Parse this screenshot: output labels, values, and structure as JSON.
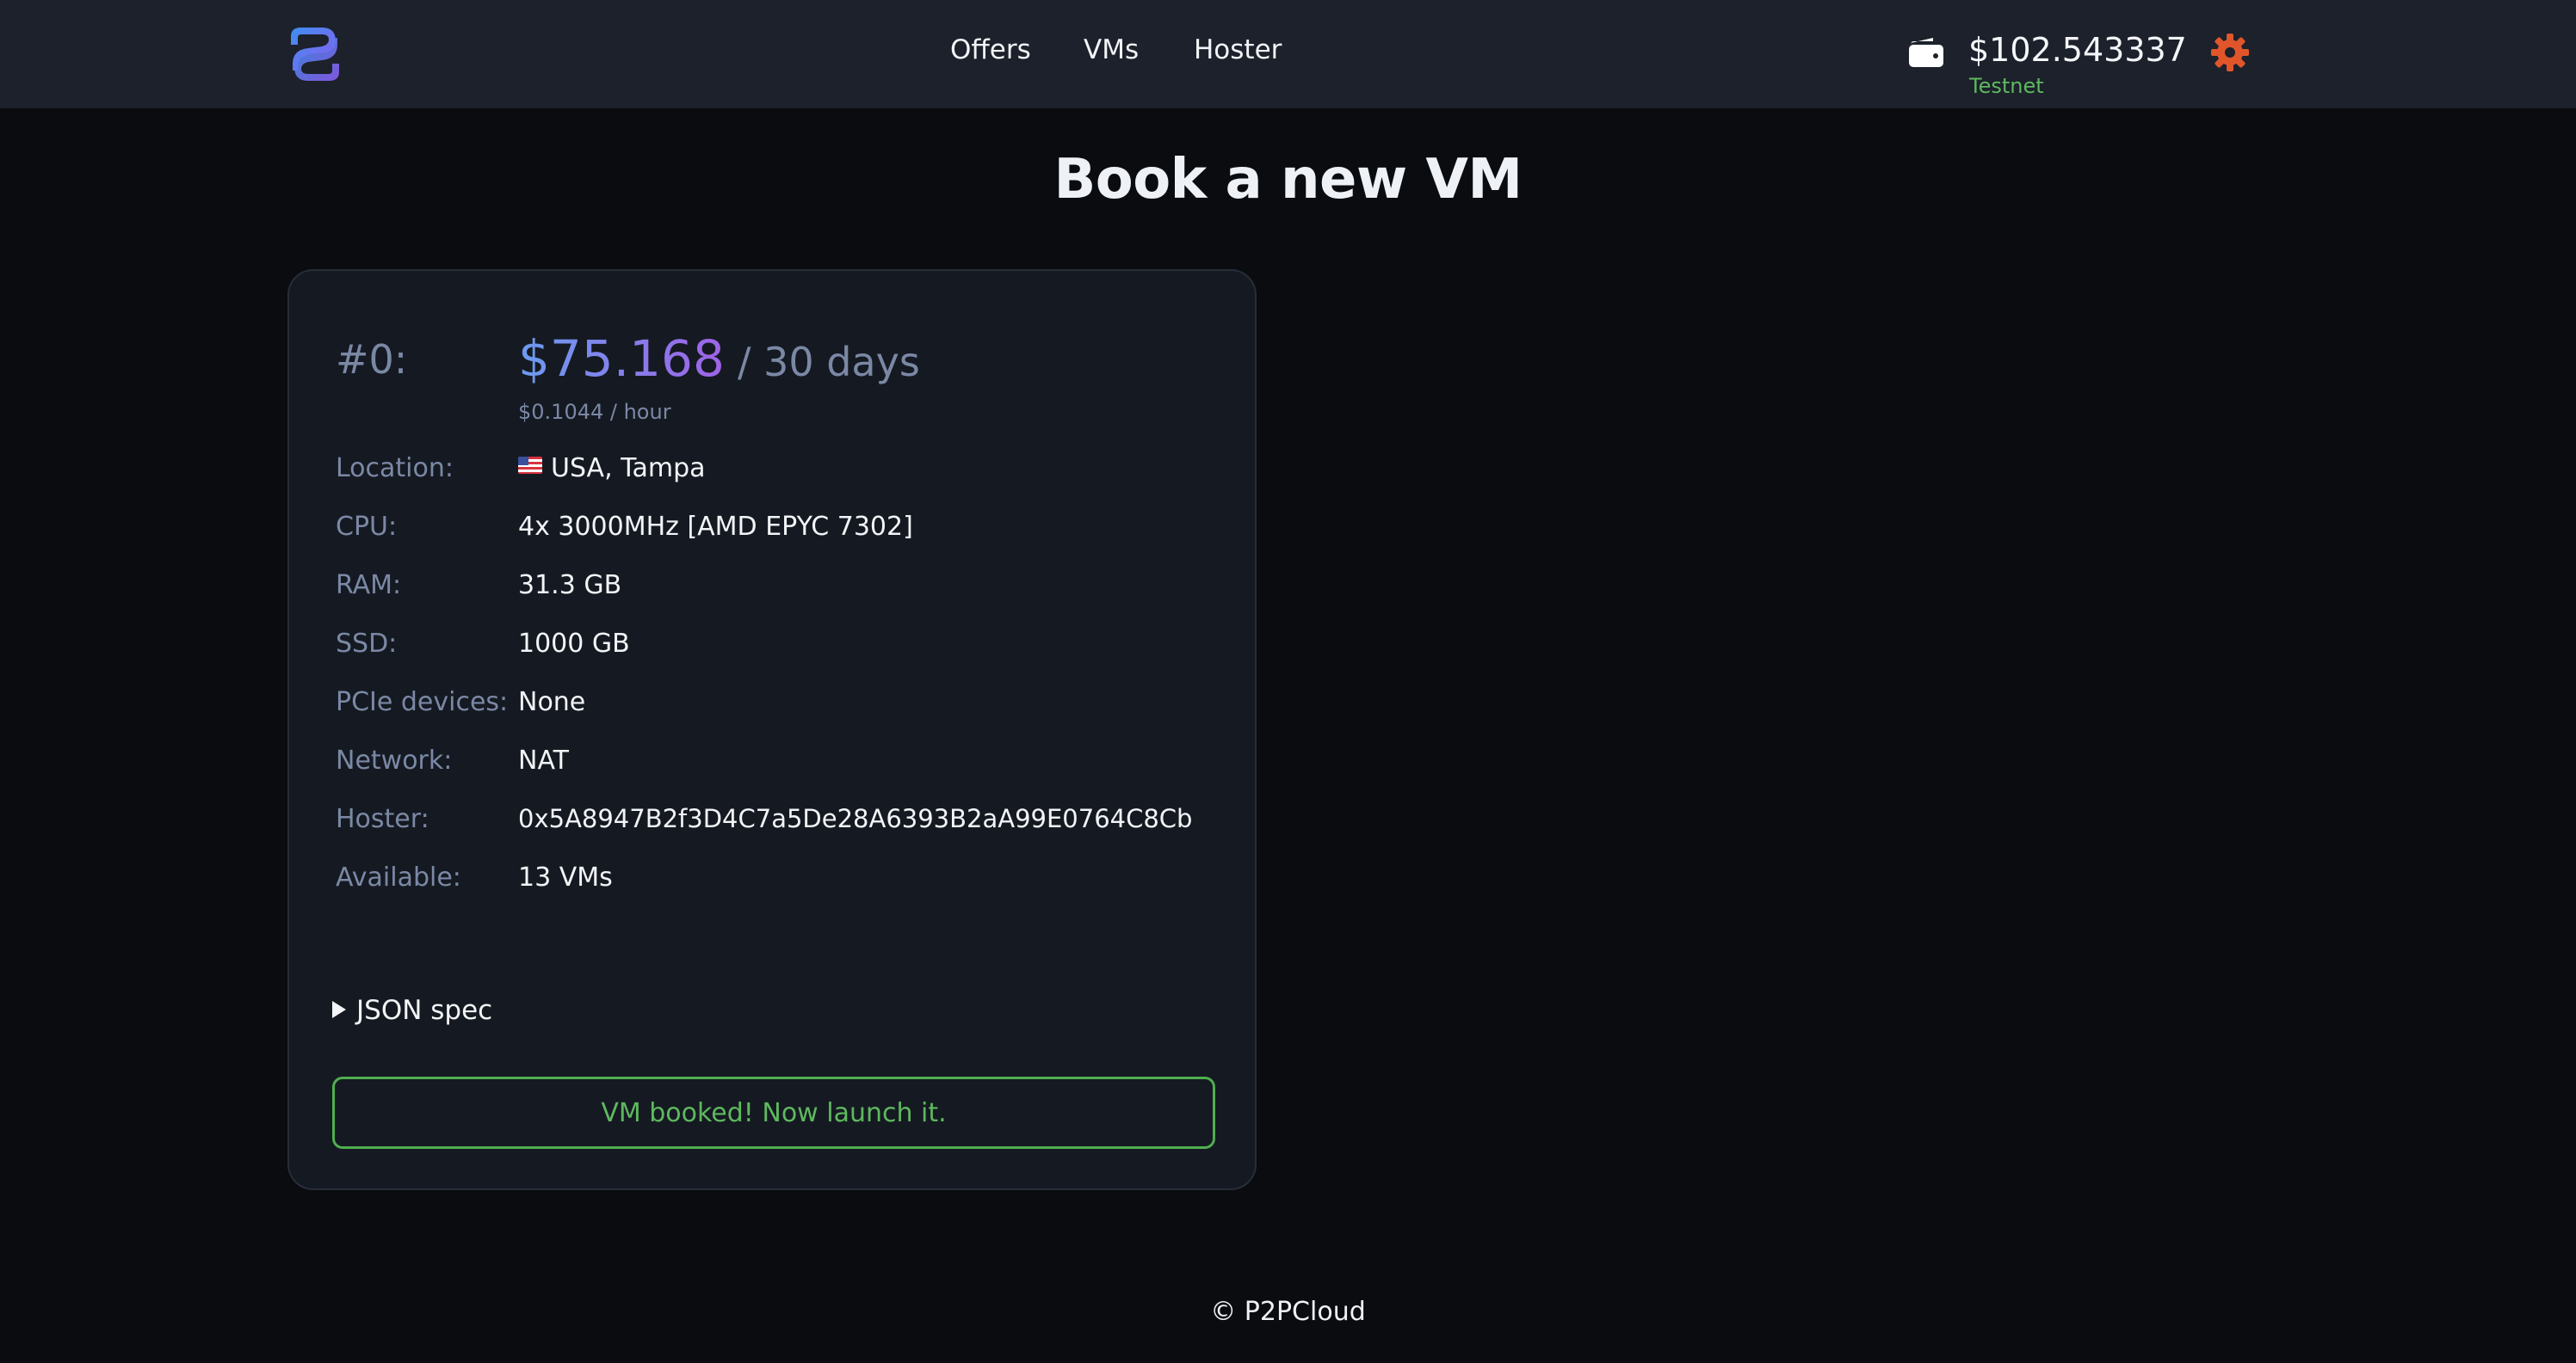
{
  "header": {
    "logo": "p2pcloud-logo",
    "nav": [
      {
        "label": "Offers"
      },
      {
        "label": "VMs"
      },
      {
        "label": "Hoster"
      }
    ],
    "wallet": {
      "icon": "wallet-icon",
      "balance": "$102.543337",
      "network": "Testnet"
    },
    "settings_icon": "gear-icon"
  },
  "page": {
    "title": "Book a new VM"
  },
  "offer": {
    "index": "#0:",
    "price": "$75.168",
    "period": "/ 30 days",
    "hourly": "$0.1044 / hour",
    "specs": [
      {
        "label": "Location:",
        "value": "USA, Tampa",
        "flag": "us-flag"
      },
      {
        "label": "CPU:",
        "value": "4x 3000MHz [AMD EPYC 7302]"
      },
      {
        "label": "RAM:",
        "value": "31.3 GB"
      },
      {
        "label": "SSD:",
        "value": "1000 GB"
      },
      {
        "label": "PCIe devices:",
        "value": "None"
      },
      {
        "label": "Network:",
        "value": "NAT"
      },
      {
        "label": "Hoster:",
        "value": "0x5A8947B2f3D4C7a5De28A6393B2aA99E0764C8Cb"
      },
      {
        "label": "Available:",
        "value": "13 VMs"
      }
    ],
    "json_spec_label": "JSON spec",
    "action_label": "VM booked! Now launch it."
  },
  "footer": {
    "text": "© P2PCloud"
  },
  "colors": {
    "accent_green": "#5fb85f",
    "price_gradient_start": "#6a9cf0",
    "price_gradient_end": "#9f63e6",
    "gear": "#e0562a"
  }
}
